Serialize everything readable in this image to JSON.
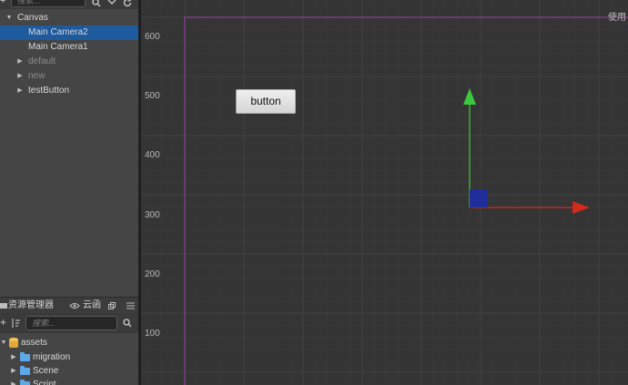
{
  "hierarchy": {
    "search_placeholder": "搜索...",
    "items": [
      {
        "label": "Canvas",
        "depth": 0,
        "expanded": true,
        "has_children": true
      },
      {
        "label": "Main Camera2",
        "depth": 1,
        "selected": true
      },
      {
        "label": "Main Camera1",
        "depth": 1
      },
      {
        "label": "default",
        "depth": 1,
        "has_children": true,
        "dim": true
      },
      {
        "label": "new",
        "depth": 1,
        "has_children": true,
        "dim": true
      },
      {
        "label": "testButton",
        "depth": 1,
        "has_children": true
      }
    ]
  },
  "assets": {
    "tab_label": "资源管理器",
    "cloud_tab_label": "云函",
    "search_placeholder": "搜索...",
    "items": [
      {
        "label": "assets",
        "depth": 0,
        "expanded": true,
        "icon": "database-icon"
      },
      {
        "label": "migration",
        "depth": 1,
        "icon": "folder-icon"
      },
      {
        "label": "Scene",
        "depth": 1,
        "icon": "folder-icon"
      },
      {
        "label": "Script",
        "depth": 1,
        "icon": "folder-icon"
      }
    ]
  },
  "scene": {
    "use_label": "使用",
    "y_axis_labels": [
      "600",
      "500",
      "400",
      "300",
      "200",
      "100"
    ],
    "button_label": "button",
    "colors": {
      "frame": "#a43ab3",
      "gizmo_y": "#3cc83c",
      "gizmo_x": "#d12a1e",
      "gizmo_center": "#1f2e9a",
      "grid": "#414141"
    }
  }
}
